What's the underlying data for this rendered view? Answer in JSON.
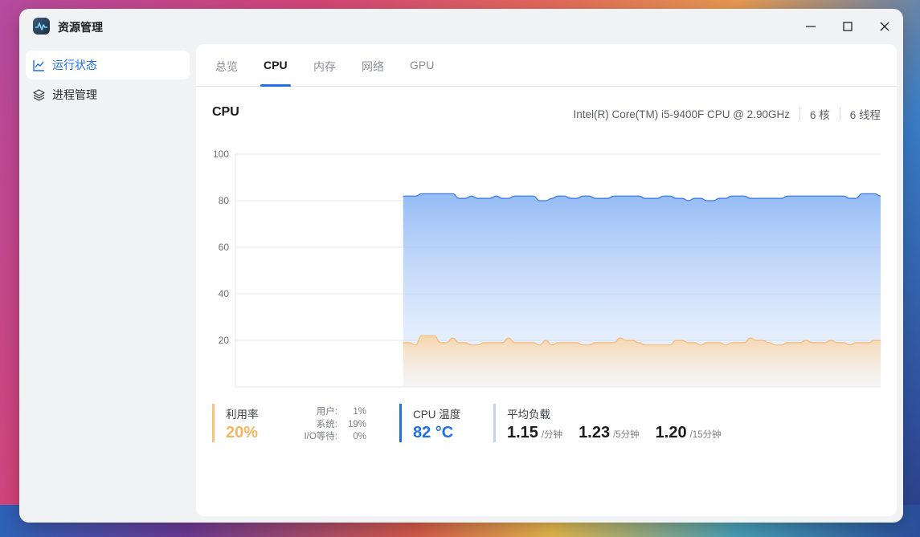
{
  "window": {
    "title": "资源管理"
  },
  "sidebar": {
    "items": [
      {
        "label": "运行状态",
        "icon": "chart-line-icon",
        "active": true
      },
      {
        "label": "进程管理",
        "icon": "layers-icon",
        "active": false
      }
    ]
  },
  "tabs": [
    {
      "label": "总览",
      "active": false
    },
    {
      "label": "CPU",
      "active": true
    },
    {
      "label": "内存",
      "active": false
    },
    {
      "label": "网络",
      "active": false
    },
    {
      "label": "GPU",
      "active": false
    }
  ],
  "cpu": {
    "heading": "CPU",
    "model": "Intel(R) Core(TM) i5-9400F CPU @ 2.90GHz",
    "cores": "6 核",
    "threads": "6 线程"
  },
  "chart_data": {
    "type": "area",
    "title": "",
    "xlabel": "",
    "ylabel": "",
    "ylim": [
      0,
      100
    ],
    "yticks": [
      20,
      40,
      60,
      80,
      100
    ],
    "grid": true,
    "series": [
      {
        "color": "#2f74e8",
        "values": [
          82,
          82,
          82,
          83,
          83,
          83,
          83,
          83,
          83,
          81,
          81,
          82,
          81,
          81,
          81,
          82,
          81,
          81,
          82,
          82,
          82,
          82,
          80,
          80,
          81,
          82,
          82,
          81,
          81,
          82,
          82,
          81,
          81,
          81,
          82,
          82,
          82,
          82,
          82,
          81,
          81,
          81,
          82,
          82,
          81,
          81,
          80,
          81,
          81,
          80,
          80,
          81,
          81,
          82,
          82,
          82,
          81,
          81,
          81,
          81,
          81,
          81,
          82,
          82,
          82,
          82,
          82,
          82,
          82,
          82,
          82,
          82,
          81,
          81,
          83,
          83,
          83,
          82
        ]
      },
      {
        "color": "#f5b971",
        "values": [
          19,
          19,
          18,
          22,
          22,
          22,
          19,
          19,
          21,
          19,
          19,
          18,
          18,
          19,
          19,
          19,
          19,
          21,
          19,
          19,
          19,
          19,
          18,
          20,
          18,
          19,
          19,
          19,
          19,
          18,
          18,
          19,
          19,
          19,
          19,
          21,
          20,
          20,
          19,
          18,
          18,
          18,
          18,
          18,
          20,
          20,
          19,
          19,
          18,
          19,
          19,
          19,
          18,
          19,
          19,
          19,
          21,
          20,
          20,
          19,
          18,
          18,
          19,
          19,
          19,
          20,
          19,
          19,
          19,
          20,
          19,
          19,
          18,
          19,
          19,
          19,
          20,
          20
        ]
      }
    ],
    "start_fraction": 0.26
  },
  "stats": {
    "util_label": "利用率",
    "util_value": "20%",
    "user_label": "用户:",
    "user_value": "1%",
    "system_label": "系统:",
    "system_value": "19%",
    "io_label": "I/O等待:",
    "io_value": "0%",
    "temp_label": "CPU 温度",
    "temp_value": "82 °C",
    "load_label": "平均负载",
    "load_1": "1.15",
    "load_1_unit": "/分钟",
    "load_5": "1.23",
    "load_5_unit": "/5分钟",
    "load_15": "1.20",
    "load_15_unit": "/15分钟"
  }
}
